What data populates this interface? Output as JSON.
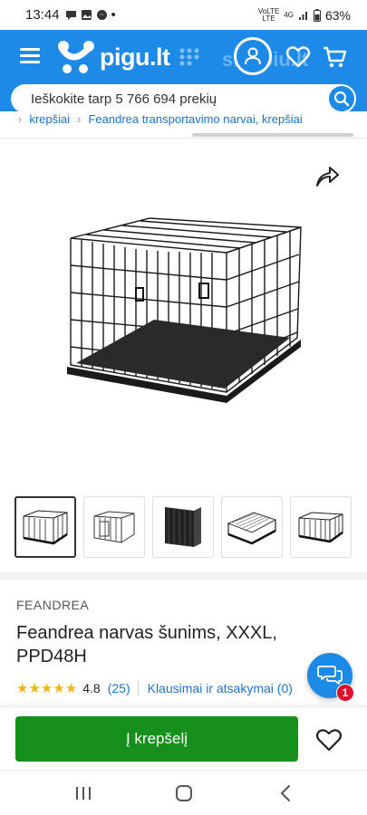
{
  "status_bar": {
    "time": "13:44",
    "dot": "•",
    "network_label_1": "VoLTE",
    "network_label_2": "LTE",
    "network_type": "4G",
    "battery": "63%"
  },
  "header": {
    "logo_text": "pigu.lt",
    "watermark": "skelbiu.lt",
    "search_placeholder": "Ieškokite tarp 5 766 694 prekių",
    "brand_color": "#1d8ae8"
  },
  "breadcrumb": {
    "items": [
      "krepšiai",
      "Feandrea transportavimo narvai, krepšiai"
    ]
  },
  "gallery": {
    "thumbnail_count": 5,
    "active_index": 0
  },
  "product": {
    "brand": "FEANDREA",
    "title": "Feandrea narvas šunims, XXXL, PPD48H",
    "stars": "★★★★★",
    "rating": "4.8",
    "review_count": "(25)",
    "qa_link": "Klausimai ir atsakymai (0)"
  },
  "chat": {
    "badge": "1"
  },
  "actions": {
    "add_to_cart": "Į krepšelį",
    "button_color": "#178f1c"
  },
  "icons": {
    "menu": "menu-icon",
    "account": "user-icon",
    "wishlist": "heart-icon",
    "cart": "cart-icon",
    "search": "search-icon",
    "share": "share-icon",
    "chat": "chat-icon"
  }
}
